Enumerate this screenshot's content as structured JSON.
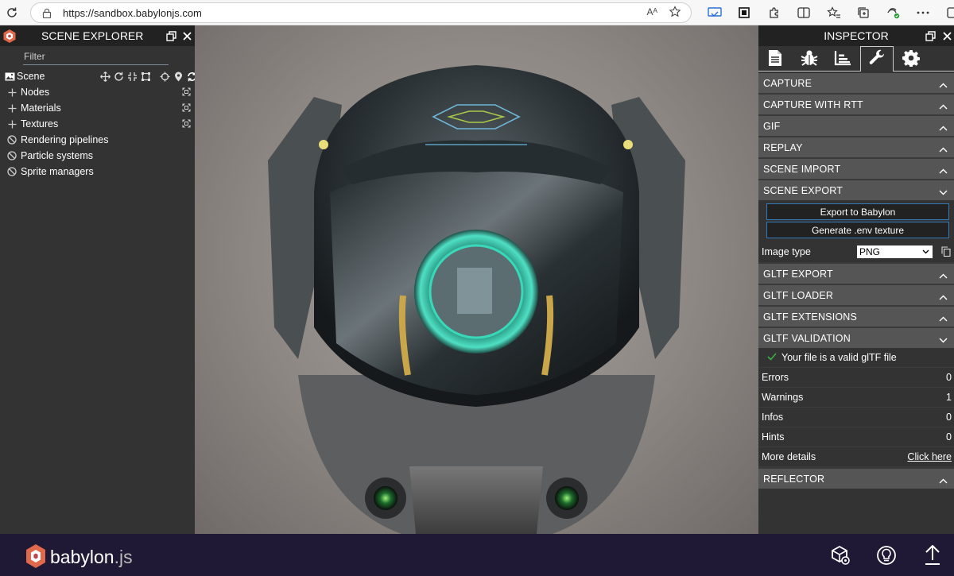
{
  "browser": {
    "url": "https://sandbox.babylonjs.com",
    "reader_label": "Aᴬ"
  },
  "explorer": {
    "title": "SCENE EXPLORER",
    "filter_placeholder": "Filter",
    "scene_label": "Scene",
    "items": [
      {
        "label": "Nodes",
        "icon": "plus-icon",
        "expandable": true
      },
      {
        "label": "Materials",
        "icon": "plus-icon",
        "expandable": true
      },
      {
        "label": "Textures",
        "icon": "plus-icon",
        "expandable": true
      },
      {
        "label": "Rendering pipelines",
        "icon": "ban-icon",
        "expandable": false
      },
      {
        "label": "Particle systems",
        "icon": "ban-icon",
        "expandable": false
      },
      {
        "label": "Sprite managers",
        "icon": "ban-icon",
        "expandable": false
      }
    ]
  },
  "inspector": {
    "title": "INSPECTOR",
    "tabs": [
      "file-icon",
      "bug-icon",
      "chart-icon",
      "wrench-icon",
      "gear-icon"
    ],
    "active_tab": "wrench-icon",
    "sections": {
      "capture": "CAPTURE",
      "capture_rtt": "CAPTURE WITH RTT",
      "gif": "GIF",
      "replay": "REPLAY",
      "scene_import": "SCENE IMPORT",
      "scene_export": "SCENE EXPORT",
      "gltf_export": "GLTF EXPORT",
      "gltf_loader": "GLTF LOADER",
      "gltf_extensions": "GLTF EXTENSIONS",
      "gltf_validation": "GLTF VALIDATION",
      "reflector": "REFLECTOR"
    },
    "scene_export": {
      "export_babylon": "Export to Babylon",
      "generate_env": "Generate .env texture",
      "image_type_label": "Image type",
      "image_type_value": "PNG"
    },
    "gltf_validation": {
      "valid_message": "Your file is a valid glTF file",
      "rows": [
        {
          "label": "Errors",
          "value": "0"
        },
        {
          "label": "Warnings",
          "value": "1"
        },
        {
          "label": "Infos",
          "value": "0"
        },
        {
          "label": "Hints",
          "value": "0"
        }
      ],
      "more_details_label": "More details",
      "more_details_link": "Click here"
    }
  },
  "footer": {
    "brand": "babylon",
    "brand_suffix": ".js"
  },
  "colors": {
    "panel_bg": "#333333",
    "header_bg": "#222222",
    "section_bg": "#555555",
    "footer_bg": "#201936",
    "accent": "#337ab7"
  }
}
